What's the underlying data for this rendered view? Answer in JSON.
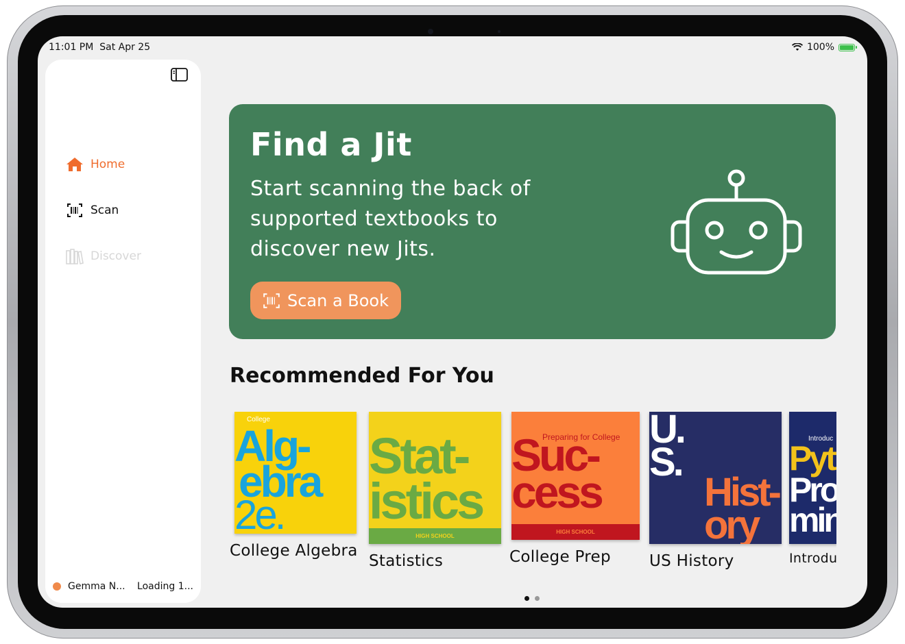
{
  "status_bar": {
    "time": "11:01 PM",
    "date": "Sat Apr 25",
    "battery": "100%",
    "battery_level": 1.0
  },
  "sidebar": {
    "nav": [
      {
        "label": "Home",
        "icon": "house-icon",
        "active": true
      },
      {
        "label": "Scan",
        "icon": "barcode-scan-icon",
        "active": false
      },
      {
        "label": "Discover",
        "icon": "library-books-icon",
        "active": false,
        "disabled": true
      }
    ],
    "footer": {
      "user": "Gemma N...",
      "status": "Loading 1..."
    }
  },
  "hero": {
    "title": "Find a Jit",
    "subtitle": "Start scanning the back of supported textbooks to discover new Jits.",
    "button_label": "Scan a Book"
  },
  "recommended": {
    "title": "Recommended For You",
    "books": [
      {
        "label": "College Algebra",
        "cover_top": "College",
        "cover_lines": [
          "Alg-",
          "ebra",
          "2e."
        ]
      },
      {
        "label": "Statistics",
        "cover_lines": [
          "Stat-",
          "istics"
        ],
        "cover_band": "HIGH SCHOOL"
      },
      {
        "label": "College Prep",
        "cover_top": "Preparing for College",
        "cover_lines": [
          "Suc-",
          "cess"
        ],
        "cover_band": "HIGH SCHOOL"
      },
      {
        "label": "US History",
        "cover_lines": [
          "U.",
          "S.",
          "Hist-",
          "ory"
        ]
      },
      {
        "label": "Introdu",
        "cover_top": "Introduc",
        "cover_lines": [
          "Pyt",
          "Pro",
          "min"
        ]
      }
    ]
  },
  "pagination": {
    "pages": 2,
    "current": 1
  },
  "colors": {
    "accent": "#ef6c2d",
    "hero_bg": "#427f59",
    "button_bg": "#f0955c"
  }
}
